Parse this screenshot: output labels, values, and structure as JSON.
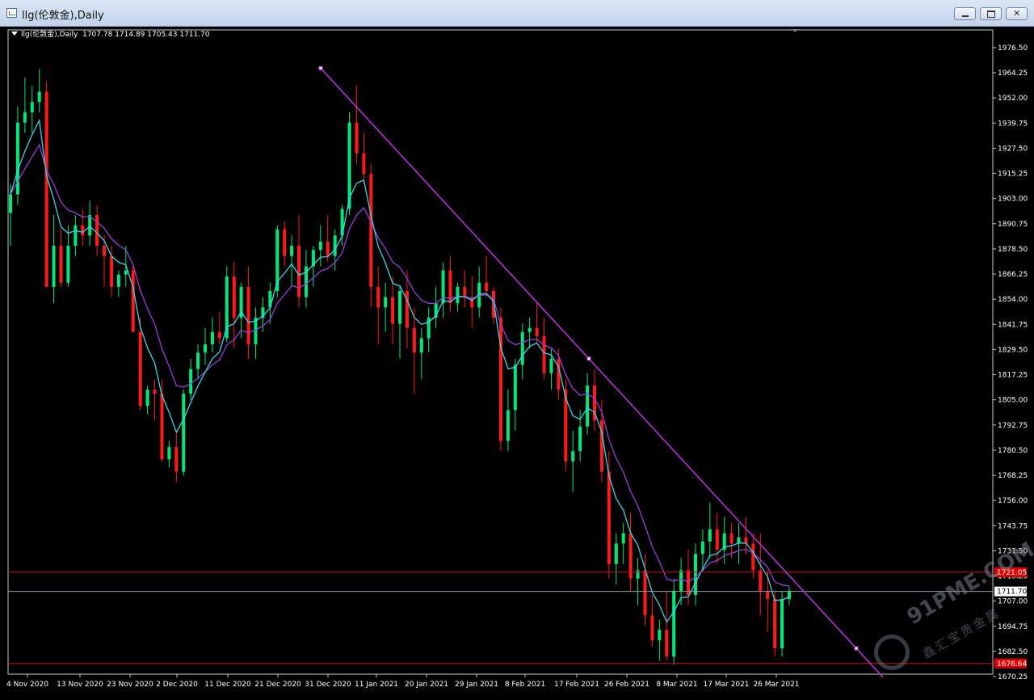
{
  "window": {
    "title": "llg(伦敦金),Daily",
    "controls": {
      "minimize": "minimize-icon",
      "maximize": "maximize-icon",
      "close": "close-icon"
    }
  },
  "chart_info": {
    "label": "llg(伦敦金),Daily",
    "ohlc": "1707.78 1714.89 1705.43 1711.70"
  },
  "colors": {
    "bull": "#00e87a",
    "bear": "#ff1a1a",
    "ma_fast": "#3ad6e8",
    "ma_slow": "#9a3fd8",
    "trendline": "#b72ed8",
    "hline": "#c81414",
    "bid_line": "#8fa5b5"
  },
  "watermark": {
    "text": "91PME.COM",
    "sub": "鑫汇宝贵金属"
  },
  "chart_data": {
    "type": "candlestick",
    "symbol": "llg(伦敦金)",
    "timeframe": "Daily",
    "ylim": [
      1670.25,
      1982.75
    ],
    "y_ticks": [
      "1976.50",
      "1964.25",
      "1952.00",
      "1939.75",
      "1927.50",
      "1915.25",
      "1903.00",
      "1890.75",
      "1878.50",
      "1866.25",
      "1854.00",
      "1841.75",
      "1829.50",
      "1817.25",
      "1805.00",
      "1792.75",
      "1780.50",
      "1768.25",
      "1756.00",
      "1743.75",
      "1731.50",
      "1719.25",
      "1707.00",
      "1694.75",
      "1682.50",
      "1670.25"
    ],
    "x_labels": [
      "4 Nov 2020",
      "13 Nov 2020",
      "23 Nov 2020",
      "2 Dec 2020",
      "11 Dec 2020",
      "21 Dec 2020",
      "31 Dec 2020",
      "11 Jan 2021",
      "20 Jan 2021",
      "29 Jan 2021",
      "8 Feb 2021",
      "17 Feb 2021",
      "26 Feb 2021",
      "8 Mar 2021",
      "17 Mar 2021",
      "26 Mar 2021"
    ],
    "current_price": "1711.70",
    "hlines": [
      {
        "value": 1721.05,
        "label": "1721.05"
      },
      {
        "value": 1676.64,
        "label": "1676.64"
      }
    ],
    "trendline": {
      "from": {
        "date": "31 Dec 2020",
        "price": 1966.5
      },
      "to": {
        "date": "30 Mar 2021",
        "price": 1684.0
      }
    },
    "candles": [
      [
        1896,
        1910,
        1880,
        1905
      ],
      [
        1905,
        1948,
        1900,
        1940
      ],
      [
        1940,
        1962,
        1935,
        1945
      ],
      [
        1945,
        1958,
        1935,
        1950
      ],
      [
        1950,
        1966,
        1945,
        1955
      ],
      [
        1955,
        1960,
        1860,
        1860
      ],
      [
        1860,
        1895,
        1852,
        1880
      ],
      [
        1880,
        1888,
        1860,
        1862
      ],
      [
        1862,
        1890,
        1860,
        1880
      ],
      [
        1880,
        1895,
        1875,
        1890
      ],
      [
        1890,
        1898,
        1880,
        1885
      ],
      [
        1885,
        1902,
        1880,
        1895
      ],
      [
        1895,
        1900,
        1875,
        1880
      ],
      [
        1880,
        1885,
        1860,
        1875
      ],
      [
        1875,
        1880,
        1855,
        1860
      ],
      [
        1860,
        1868,
        1855,
        1866
      ],
      [
        1866,
        1880,
        1860,
        1868
      ],
      [
        1868,
        1870,
        1838,
        1838
      ],
      [
        1838,
        1845,
        1800,
        1802
      ],
      [
        1802,
        1812,
        1798,
        1810
      ],
      [
        1810,
        1815,
        1795,
        1808
      ],
      [
        1808,
        1815,
        1775,
        1776
      ],
      [
        1776,
        1785,
        1772,
        1782
      ],
      [
        1782,
        1790,
        1765,
        1770
      ],
      [
        1770,
        1810,
        1768,
        1808
      ],
      [
        1808,
        1825,
        1805,
        1820
      ],
      [
        1820,
        1832,
        1815,
        1828
      ],
      [
        1828,
        1840,
        1822,
        1832
      ],
      [
        1832,
        1845,
        1828,
        1838
      ],
      [
        1838,
        1848,
        1832,
        1835
      ],
      [
        1835,
        1870,
        1833,
        1865
      ],
      [
        1865,
        1872,
        1830,
        1845
      ],
      [
        1845,
        1862,
        1835,
        1860
      ],
      [
        1860,
        1870,
        1825,
        1832
      ],
      [
        1832,
        1850,
        1825,
        1845
      ],
      [
        1845,
        1855,
        1838,
        1850
      ],
      [
        1850,
        1862,
        1842,
        1858
      ],
      [
        1858,
        1890,
        1855,
        1888
      ],
      [
        1888,
        1892,
        1870,
        1875
      ],
      [
        1875,
        1885,
        1860,
        1880
      ],
      [
        1880,
        1895,
        1850,
        1855
      ],
      [
        1855,
        1878,
        1850,
        1870
      ],
      [
        1870,
        1880,
        1860,
        1878
      ],
      [
        1878,
        1890,
        1870,
        1882
      ],
      [
        1882,
        1895,
        1872,
        1875
      ],
      [
        1875,
        1888,
        1868,
        1885
      ],
      [
        1885,
        1900,
        1880,
        1898
      ],
      [
        1898,
        1945,
        1895,
        1940
      ],
      [
        1940,
        1958,
        1920,
        1925
      ],
      [
        1925,
        1935,
        1910,
        1915
      ],
      [
        1915,
        1920,
        1850,
        1860
      ],
      [
        1860,
        1870,
        1832,
        1850
      ],
      [
        1850,
        1862,
        1838,
        1855
      ],
      [
        1855,
        1865,
        1832,
        1842
      ],
      [
        1842,
        1860,
        1825,
        1858
      ],
      [
        1858,
        1868,
        1830,
        1840
      ],
      [
        1840,
        1850,
        1808,
        1828
      ],
      [
        1828,
        1840,
        1815,
        1835
      ],
      [
        1835,
        1850,
        1828,
        1845
      ],
      [
        1845,
        1860,
        1840,
        1852
      ],
      [
        1852,
        1872,
        1845,
        1868
      ],
      [
        1868,
        1875,
        1848,
        1852
      ],
      [
        1852,
        1862,
        1848,
        1860
      ],
      [
        1860,
        1868,
        1850,
        1855
      ],
      [
        1855,
        1865,
        1840,
        1850
      ],
      [
        1850,
        1870,
        1845,
        1862
      ],
      [
        1862,
        1875,
        1855,
        1858
      ],
      [
        1858,
        1860,
        1842,
        1845
      ],
      [
        1845,
        1850,
        1780,
        1785
      ],
      [
        1785,
        1810,
        1780,
        1800
      ],
      [
        1800,
        1825,
        1790,
        1822
      ],
      [
        1822,
        1842,
        1815,
        1838
      ],
      [
        1838,
        1845,
        1830,
        1840
      ],
      [
        1840,
        1852,
        1832,
        1836
      ],
      [
        1836,
        1845,
        1815,
        1818
      ],
      [
        1818,
        1830,
        1810,
        1825
      ],
      [
        1825,
        1830,
        1805,
        1810
      ],
      [
        1810,
        1815,
        1770,
        1775
      ],
      [
        1775,
        1790,
        1760,
        1780
      ],
      [
        1780,
        1800,
        1775,
        1792
      ],
      [
        1792,
        1818,
        1788,
        1812
      ],
      [
        1812,
        1820,
        1790,
        1795
      ],
      [
        1795,
        1805,
        1765,
        1770
      ],
      [
        1770,
        1780,
        1718,
        1725
      ],
      [
        1725,
        1740,
        1715,
        1735
      ],
      [
        1735,
        1745,
        1725,
        1740
      ],
      [
        1740,
        1750,
        1712,
        1718
      ],
      [
        1718,
        1728,
        1705,
        1722
      ],
      [
        1722,
        1730,
        1695,
        1700
      ],
      [
        1700,
        1710,
        1685,
        1688
      ],
      [
        1688,
        1698,
        1678,
        1693
      ],
      [
        1693,
        1712,
        1678,
        1680
      ],
      [
        1680,
        1718,
        1676,
        1712
      ],
      [
        1712,
        1728,
        1705,
        1722
      ],
      [
        1722,
        1732,
        1705,
        1710
      ],
      [
        1710,
        1735,
        1705,
        1730
      ],
      [
        1730,
        1742,
        1722,
        1736
      ],
      [
        1736,
        1755,
        1728,
        1742
      ],
      [
        1742,
        1750,
        1725,
        1732
      ],
      [
        1732,
        1748,
        1725,
        1740
      ],
      [
        1740,
        1745,
        1728,
        1735
      ],
      [
        1735,
        1745,
        1725,
        1738
      ],
      [
        1738,
        1748,
        1730,
        1735
      ],
      [
        1735,
        1740,
        1718,
        1722
      ],
      [
        1722,
        1740,
        1700,
        1712
      ],
      [
        1712,
        1722,
        1692,
        1708
      ],
      [
        1708,
        1712,
        1680,
        1684
      ],
      [
        1684,
        1712,
        1680,
        1708
      ],
      [
        1708,
        1714,
        1705,
        1712
      ]
    ]
  }
}
